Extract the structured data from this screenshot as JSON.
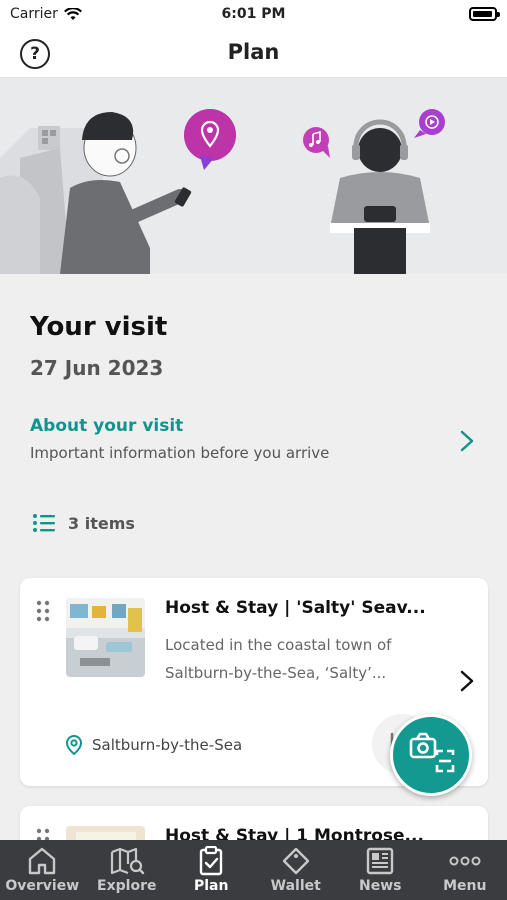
{
  "status": {
    "carrier": "Carrier",
    "time": "6:01 PM"
  },
  "nav": {
    "title": "Plan",
    "help_glyph": "?"
  },
  "visit": {
    "title": "Your visit",
    "date": "27 Jun 2023",
    "about_label": "About your visit",
    "about_sub": "Important information before you arrive",
    "items_count": "3 items"
  },
  "cards": [
    {
      "name": "Host & Stay | 'Salty' Seav...",
      "desc_line1": "Located in the coastal town of",
      "desc_line2": "Saltburn-by-the-Sea, ‘Salty’...",
      "location": "Saltburn-by-the-Sea"
    },
    {
      "name": "Host & Stay | 1 Montrose..."
    }
  ],
  "tabs": [
    {
      "label": "Overview",
      "icon": "home-icon"
    },
    {
      "label": "Explore",
      "icon": "map-search-icon"
    },
    {
      "label": "Plan",
      "icon": "clipboard-check-icon"
    },
    {
      "label": "Wallet",
      "icon": "ticket-icon"
    },
    {
      "label": "News",
      "icon": "newspaper-icon"
    },
    {
      "label": "Menu",
      "icon": "more-icon"
    }
  ],
  "colors": {
    "accent": "#10948e",
    "tab_bg": "#3a3c40",
    "page_bg": "#efefef"
  }
}
